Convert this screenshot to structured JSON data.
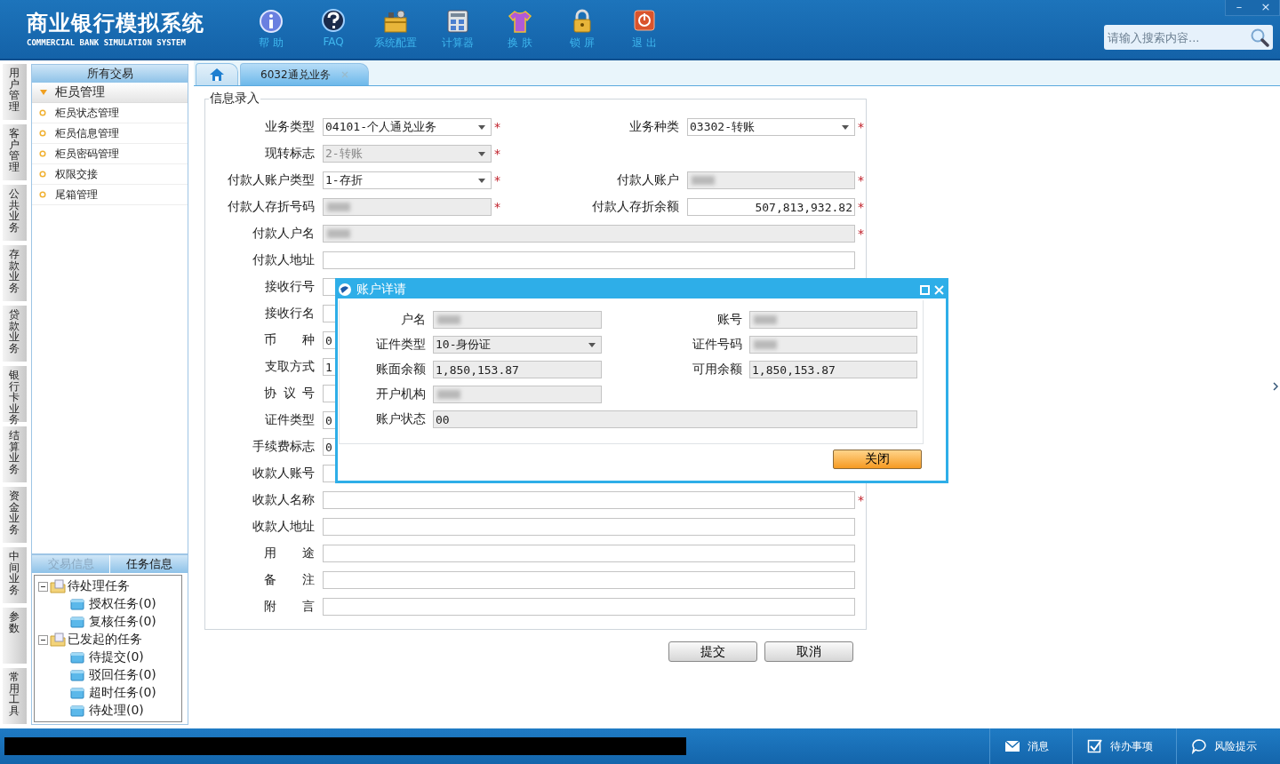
{
  "header": {
    "title": "商业银行模拟系统",
    "subtitle": "COMMERCIAL BANK SIMULATION SYSTEM",
    "toolbar": [
      {
        "kind": "info",
        "label": "帮 助"
      },
      {
        "kind": "faq",
        "label": "FAQ"
      },
      {
        "kind": "config",
        "label": "系统配置"
      },
      {
        "kind": "calculator",
        "label": "计算器"
      },
      {
        "kind": "skin",
        "label": "换 肤"
      },
      {
        "kind": "lock",
        "label": "锁 屏"
      },
      {
        "kind": "exit",
        "label": "退 出"
      }
    ],
    "search": {
      "placeholder": "请输入搜索内容..."
    },
    "window_controls": [
      "–",
      "×"
    ]
  },
  "side_tabs": [
    "用户管理",
    "客户管理",
    "公共业务",
    "存款业务",
    "贷款业务",
    "银行卡业务",
    "结算业务",
    "资金业务",
    "中间业务",
    "参数",
    "常用工具"
  ],
  "nav": {
    "header": "所有交易",
    "group": {
      "label": "柜员管理",
      "expanded": true
    },
    "items": [
      "柜员状态管理",
      "柜员信息管理",
      "柜员密码管理",
      "权限交接",
      "尾箱管理"
    ]
  },
  "task_panel": {
    "tabs": [
      {
        "label": "交易信息",
        "selected": false
      },
      {
        "label": "任务信息",
        "selected": true
      }
    ],
    "tree": [
      {
        "label": "待处理任务",
        "expanded": true,
        "children": [
          {
            "label": "授权任务(0)"
          },
          {
            "label": "复核任务(0)"
          }
        ]
      },
      {
        "label": "已发起的任务",
        "expanded": true,
        "children": [
          {
            "label": "待提交(0)"
          },
          {
            "label": "驳回任务(0)"
          },
          {
            "label": "超时任务(0)"
          },
          {
            "label": "待处理(0)"
          }
        ]
      }
    ]
  },
  "tabs": [
    {
      "kind": "home",
      "selected": false
    },
    {
      "kind": "page",
      "label": "6032通兑业务",
      "selected": true
    }
  ],
  "form": {
    "legend": "信息录入",
    "required_mark": "*",
    "rows": [
      [
        {
          "label": "业务类型",
          "kind": "select",
          "value": "04101-个人通兑业务",
          "required": true
        },
        {
          "label": "业务种类",
          "kind": "select",
          "value": "03302-转账",
          "required": true
        }
      ],
      [
        {
          "label": "现转标志",
          "kind": "select",
          "value": "2-转账",
          "required": true,
          "disabled": true
        }
      ],
      [
        {
          "label": "付款人账户类型",
          "kind": "select",
          "value": "1-存折",
          "required": true
        },
        {
          "label": "付款人账户",
          "kind": "text",
          "redacted": true,
          "readonly": true,
          "required": true
        }
      ],
      [
        {
          "label": "付款人存折号码",
          "kind": "text",
          "redacted": true,
          "readonly": true,
          "required": true
        },
        {
          "label": "付款人存折余额",
          "kind": "amount",
          "value": "507,813,932.82",
          "required": true
        }
      ],
      [
        {
          "label": "付款人户名",
          "kind": "text",
          "wide": true,
          "redacted": true,
          "readonly": true,
          "required": true
        }
      ],
      [
        {
          "label": "付款人地址",
          "kind": "text",
          "wide": true
        }
      ],
      [
        {
          "label": "接收行号",
          "kind": "text"
        }
      ],
      [
        {
          "label": "接收行名",
          "kind": "text"
        }
      ],
      [
        {
          "label": "币种",
          "kind": "text",
          "spaced": true,
          "value": "0"
        }
      ],
      [
        {
          "label": "支取方式",
          "kind": "text",
          "value": "1"
        }
      ],
      [
        {
          "label": "协议号",
          "kind": "text",
          "spaced": true
        }
      ],
      [
        {
          "label": "证件类型",
          "kind": "text",
          "value": "0"
        }
      ],
      [
        {
          "label": "手续费标志",
          "kind": "text",
          "value": "0"
        }
      ],
      [
        {
          "label": "收款人账号",
          "kind": "text"
        }
      ],
      [
        {
          "label": "收款人名称",
          "kind": "text",
          "wide": true,
          "required": true
        }
      ],
      [
        {
          "label": "收款人地址",
          "kind": "text",
          "wide": true
        }
      ],
      [
        {
          "label": "用途",
          "kind": "text",
          "wide": true,
          "spaced": true
        }
      ],
      [
        {
          "label": "备注",
          "kind": "text",
          "wide": true,
          "spaced": true
        }
      ],
      [
        {
          "label": "附言",
          "kind": "text",
          "wide": true,
          "spaced": true
        }
      ]
    ],
    "buttons": [
      "提交",
      "取消"
    ]
  },
  "dialog": {
    "title": "账户详请",
    "rows": [
      [
        {
          "label": "户名",
          "kind": "text",
          "redacted": true
        },
        {
          "label": "账号",
          "kind": "text",
          "redacted": true
        }
      ],
      [
        {
          "label": "证件类型",
          "kind": "select",
          "value": "10-身份证"
        },
        {
          "label": "证件号码",
          "kind": "text",
          "redacted": true
        }
      ],
      [
        {
          "label": "账面余额",
          "kind": "text",
          "value": "1,850,153.87"
        },
        {
          "label": "可用余额",
          "kind": "text",
          "value": "1,850,153.87"
        }
      ],
      [
        {
          "label": "开户机构",
          "kind": "text",
          "redacted": true
        }
      ],
      [
        {
          "label": "账户状态",
          "kind": "text",
          "value": "00",
          "wide": true
        }
      ]
    ],
    "button": "关闭"
  },
  "status_bar": {
    "redacted": true,
    "items": [
      {
        "kind": "message",
        "label": "消息"
      },
      {
        "kind": "todo",
        "label": "待办事项"
      },
      {
        "kind": "risk",
        "label": "风险提示"
      }
    ]
  }
}
